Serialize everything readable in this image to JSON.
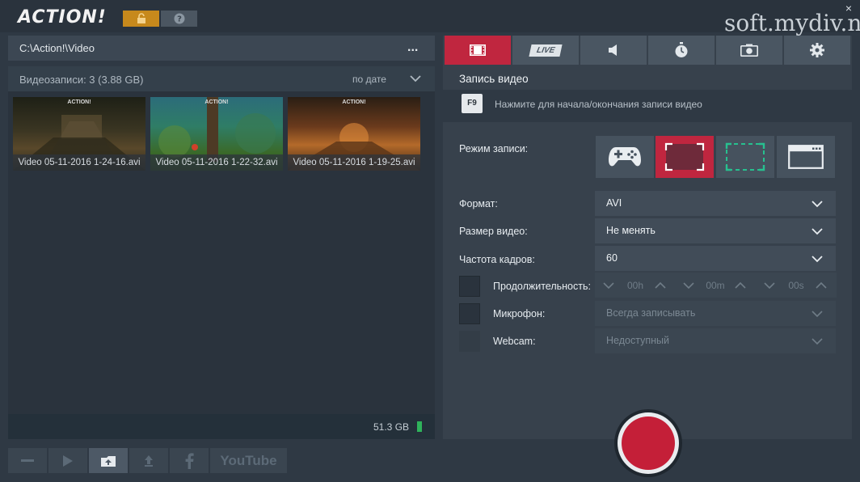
{
  "app": {
    "logo": "ACTION!",
    "watermark": "soft.mydiv.net",
    "close": "×"
  },
  "left": {
    "path": "C:\\Action!\\Video",
    "path_more": "...",
    "file_count": "Видеозаписи: 3 (3.88 GB)",
    "sort_label": "по дате",
    "thumbnails": [
      {
        "name": "Video 05-11-2016 1-24-16.avi",
        "logo": "ACTION!"
      },
      {
        "name": "Video 05-11-2016 1-22-32.avi",
        "logo": "ACTION!"
      },
      {
        "name": "Video 05-11-2016 1-19-25.avi",
        "logo": "ACTION!"
      }
    ],
    "disk_free": "51.3 GB"
  },
  "bottom_buttons": {
    "youtube": "YouTube"
  },
  "tabs": {
    "live": "LIVE",
    "active": "video"
  },
  "record": {
    "title": "Запись видео",
    "hotkey": "F9",
    "hotkey_hint": "Нажмите для начала/окончания записи видео",
    "mode_label": "Режим записи:",
    "format_label": "Формат:",
    "format_value": "AVI",
    "size_label": "Размер видео:",
    "size_value": "Не менять",
    "fps_label": "Частота кадров:",
    "fps_value": "60",
    "duration_label": "Продолжительность:",
    "duration_h": "00h",
    "duration_m": "00m",
    "duration_s": "00s",
    "mic_label": "Микрофон:",
    "mic_value": "Всегда записывать",
    "webcam_label": "Webcam:",
    "webcam_value": "Недоступный"
  },
  "colors": {
    "accent_red": "#c0263f",
    "lock_orange": "#c7891c",
    "active_green": "#27c08f"
  }
}
